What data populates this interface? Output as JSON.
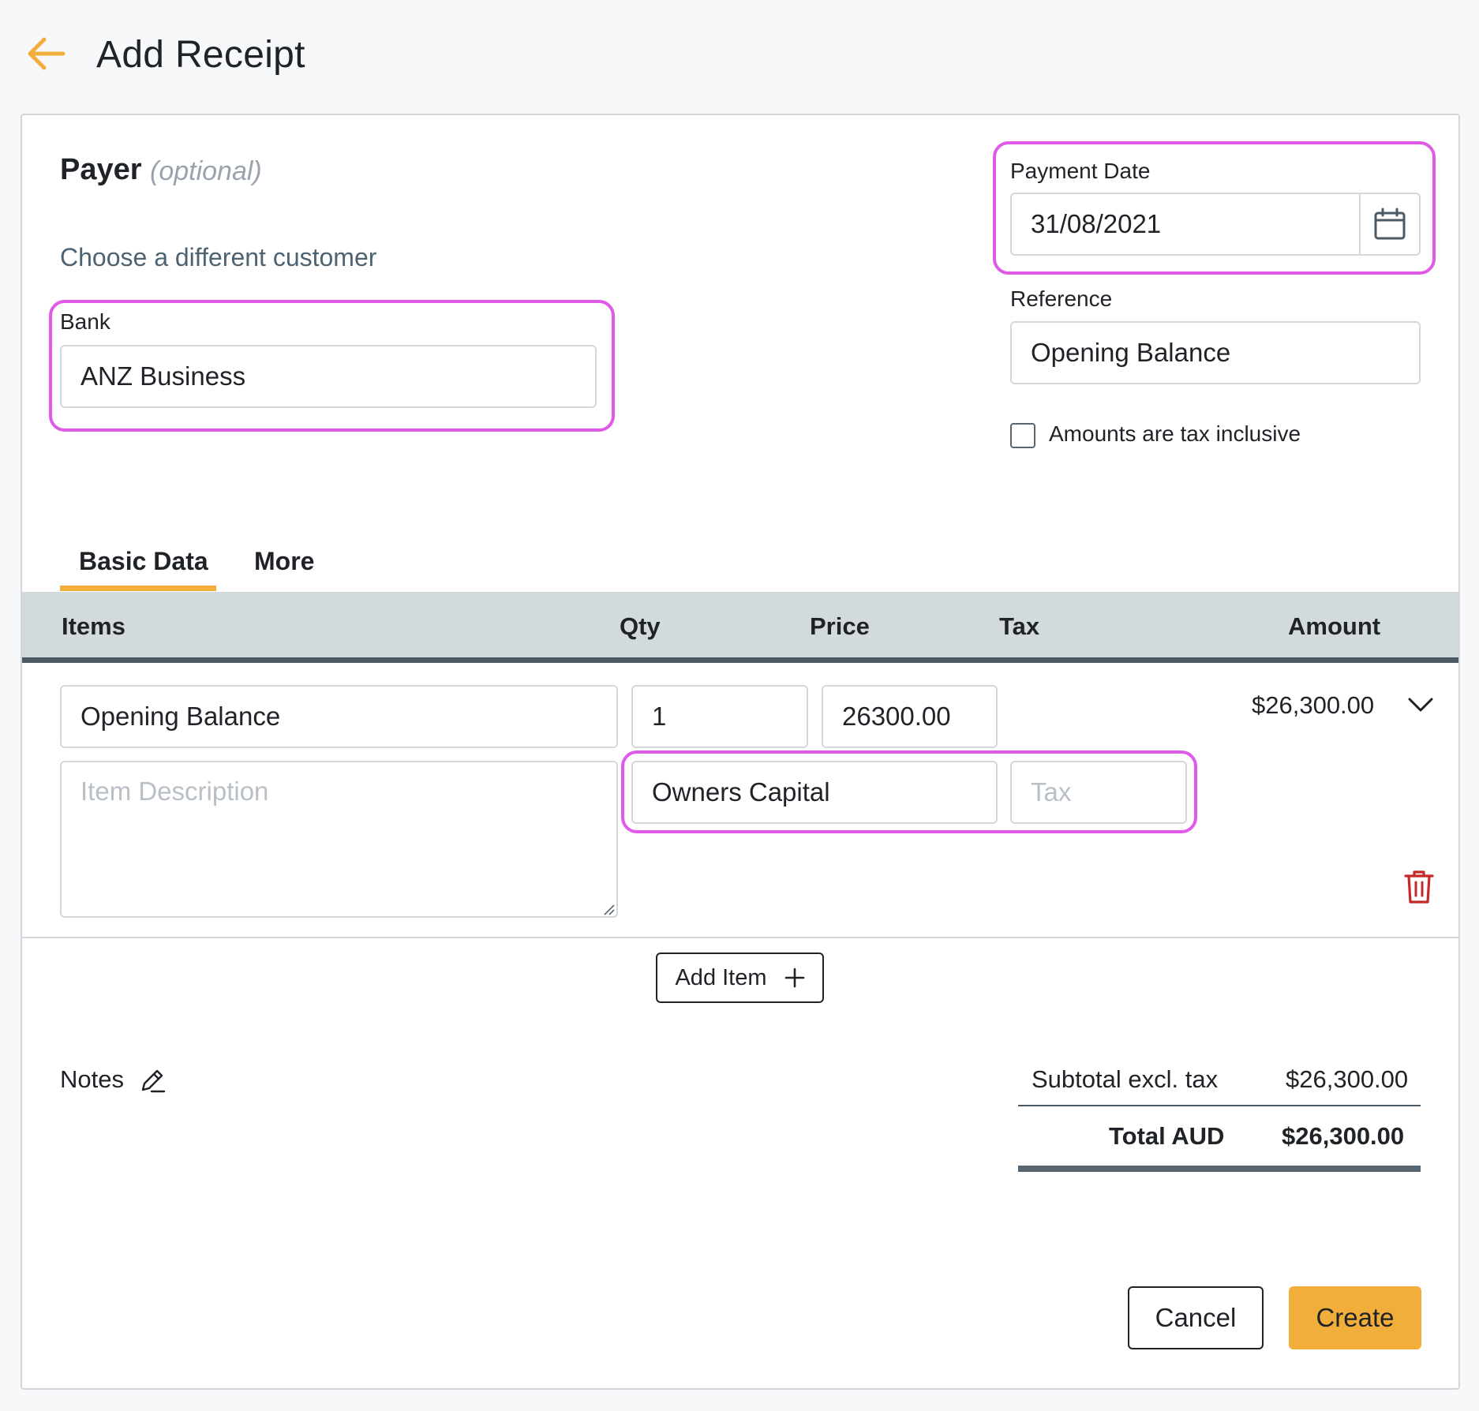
{
  "header": {
    "title": "Add Receipt",
    "back_icon": "arrow-left-icon"
  },
  "payer": {
    "title": "Payer",
    "optional_label": "(optional)",
    "choose_link": "Choose a different customer"
  },
  "bank": {
    "label": "Bank",
    "value": "ANZ Business"
  },
  "payment_date": {
    "label": "Payment Date",
    "value": "31/08/2021",
    "icon": "calendar-icon"
  },
  "reference": {
    "label": "Reference",
    "value": "Opening Balance"
  },
  "tax_inclusive": {
    "label": "Amounts are tax inclusive",
    "checked": false
  },
  "tabs": [
    {
      "label": "Basic Data",
      "active": true
    },
    {
      "label": "More",
      "active": false
    }
  ],
  "table": {
    "headers": {
      "items": "Items",
      "qty": "Qty",
      "price": "Price",
      "tax": "Tax",
      "amount": "Amount"
    },
    "rows": [
      {
        "item": "Opening Balance",
        "qty": "1",
        "price": "26300.00",
        "amount": "$26,300.00",
        "description_placeholder": "Item Description",
        "account": "Owners Capital",
        "tax_placeholder": "Tax"
      }
    ]
  },
  "add_item_label": "Add Item",
  "notes_label": "Notes",
  "summary": {
    "subtotal_label": "Subtotal excl. tax",
    "subtotal_value": "$26,300.00",
    "total_label": "Total AUD",
    "total_value": "$26,300.00"
  },
  "actions": {
    "cancel": "Cancel",
    "create": "Create"
  },
  "colors": {
    "accent": "#f2ae3b",
    "highlight": "#e05ae8",
    "danger": "#c62828",
    "link": "#4e6372"
  }
}
